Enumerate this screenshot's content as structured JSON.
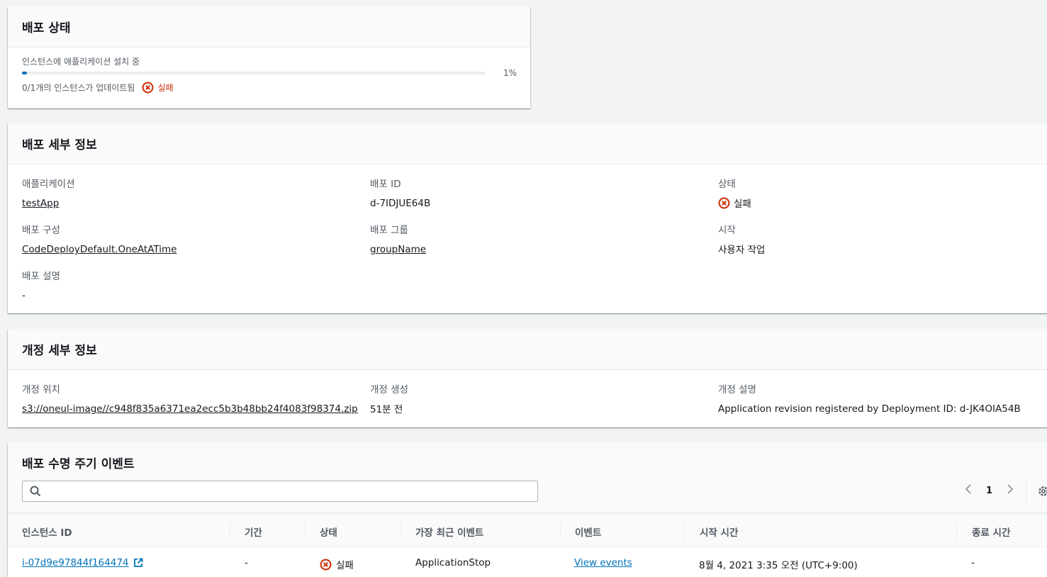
{
  "status": {
    "title": "배포 상태",
    "progress_label": "인스턴스에 애플리케이션 설치 중",
    "progress_percent": 1,
    "progress_percent_text": "1%",
    "instances_text": "0/1개의 인스턴스가 업데이트됨",
    "result": "실패"
  },
  "deployment": {
    "title": "배포 세부 정보",
    "application_label": "애플리케이션",
    "application_value": "testApp",
    "deploy_id_label": "배포 ID",
    "deploy_id_value": "d-7IDJUE64B",
    "state_label": "상태",
    "state_value": "실패",
    "config_label": "배포 구성",
    "config_value": "CodeDeployDefault.OneAtATime",
    "group_label": "배포 그룹",
    "group_value": "groupName",
    "start_label": "시작",
    "start_value": "사용자 작업",
    "desc_label": "배포 설명",
    "desc_value": "-"
  },
  "revision": {
    "title": "개정 세부 정보",
    "location_label": "개정 위치",
    "location_value": "s3://oneul-image//c948f835a6371ea2ecc5b3b48bb24f4083f98374.zip",
    "created_label": "개정 생성",
    "created_value": "51분 전",
    "desc_label": "개정 설명",
    "desc_value": "Application revision registered by Deployment ID: d-JK4OIA54B"
  },
  "events": {
    "title": "배포 수명 주기 이벤트",
    "search_placeholder": "",
    "page": "1",
    "columns": [
      "인스턴스 ID",
      "기간",
      "상태",
      "가장 최근 이벤트",
      "이벤트",
      "시작 시간",
      "종료 시간"
    ],
    "row": {
      "instance_id": "i-07d9e97844f164474",
      "duration": "-",
      "status": "실패",
      "latest_event": "ApplicationStop",
      "events_link": "View events",
      "start_time": "8월 4, 2021 3:35 오전 (UTC+9:00)",
      "end_time": "-"
    }
  },
  "colors": {
    "link": "#0073bb",
    "error": "#d13212",
    "background": "#f2f3f3"
  }
}
